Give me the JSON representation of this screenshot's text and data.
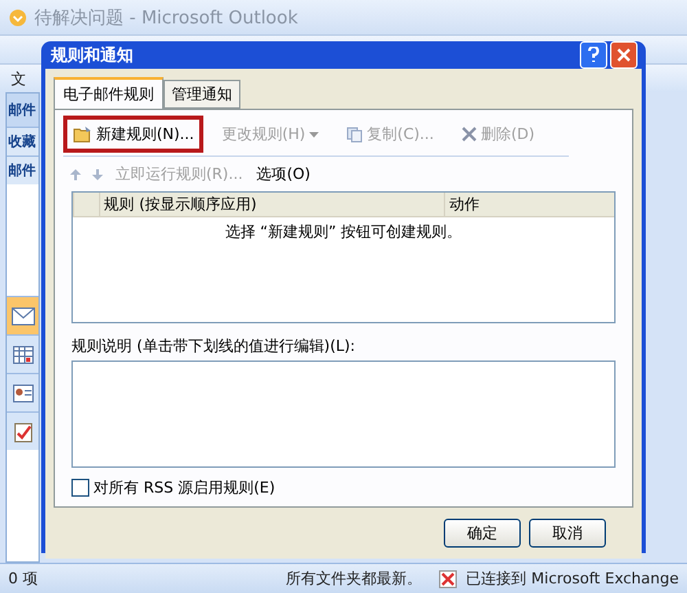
{
  "window": {
    "title": "待解决问题 - Microsoft Outlook"
  },
  "toolbar": {
    "menu_stub": "文"
  },
  "nav_pane": {
    "header": "邮件",
    "sections": [
      "收藏",
      "邮件"
    ]
  },
  "dialog": {
    "title": "规则和通知",
    "tabs": [
      {
        "label": "电子邮件规则",
        "selected": true
      },
      {
        "label": "管理通知",
        "selected": false
      }
    ],
    "actions": [
      {
        "label": "新建规则(N)...",
        "disabled": false,
        "highlighted": true,
        "kind": "new"
      },
      {
        "label": "更改规则(H)",
        "disabled": true,
        "highlighted": false,
        "kind": "dropdown"
      },
      {
        "label": "复制(C)...",
        "disabled": true,
        "highlighted": false,
        "kind": "copy"
      },
      {
        "label": "删除(D)",
        "disabled": true,
        "highlighted": false,
        "kind": "delete"
      }
    ],
    "actions2": [
      {
        "label": "立即运行规则(R)...",
        "disabled": true
      },
      {
        "label": "选项(O)",
        "disabled": false
      }
    ],
    "table": {
      "columns": [
        "规则 (按显示顺序应用)",
        "动作"
      ],
      "empty_message": "选择 “新建规则” 按钮可创建规则。"
    },
    "description_label": "规则说明 (单击带下划线的值进行编辑)(L):",
    "rss_checkbox": {
      "label": "对所有 RSS 源启用规则(E)",
      "checked": false
    },
    "buttons": [
      "确定",
      "取消"
    ]
  },
  "status_bar": {
    "count": "0 项",
    "sync": "所有文件夹都最新。",
    "connection": "已连接到 Microsoft Exchange"
  }
}
